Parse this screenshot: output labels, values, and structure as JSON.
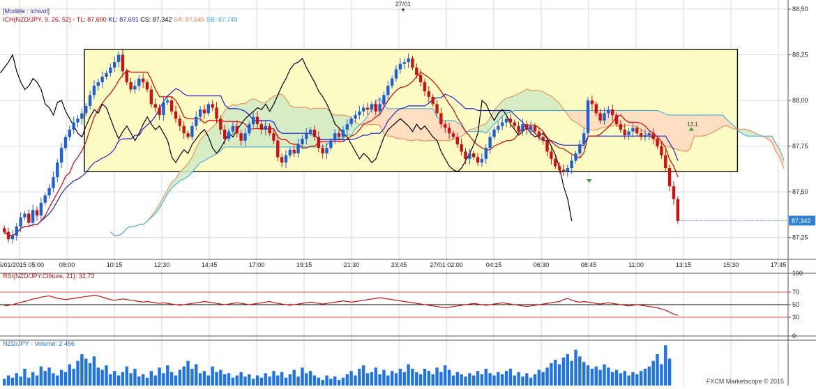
{
  "colors": {
    "background": "#ffffff",
    "grid": "#d9d9d9",
    "bull_candle": "#1f5fd6",
    "bear_candle": "#cc1111",
    "tenkan": "#d40000",
    "kijun": "#2020c8",
    "chikou": "#000000",
    "span_a": "#f0804a",
    "span_b": "#31a8dc",
    "cloud_bull": "#cfe9c4",
    "cloud_bear": "#fbd9c0",
    "cloud_blue": "#cfe6f5",
    "highlight_box": "#fdfbc4",
    "rsi_line": "#cc1111",
    "rsi_levels": "#e85050",
    "volume_bar": "#1f73e6"
  },
  "header": {
    "date_marker": "27/01",
    "model_label": "[Modèle : ichivol]",
    "ichimoku_legend": [
      {
        "text": "ICH(NZD/JPY, 9, 26, 52) -",
        "color": "#d40000"
      },
      {
        "text": "TL: 87,600",
        "color": "#d40000"
      },
      {
        "text": "KL: 87,691",
        "color": "#2020c8"
      },
      {
        "text": "CS: 87,342",
        "color": "#000000"
      },
      {
        "text": "SA: 87,645",
        "color": "#f0804a"
      },
      {
        "text": "SB: 87,749",
        "color": "#31a8dc"
      }
    ]
  },
  "price_axis": {
    "ticks": [
      "88,50",
      "88,25",
      "88,00",
      "87,75",
      "87,50",
      "87,25"
    ],
    "current_price_label": "87,342"
  },
  "time_axis": {
    "labels": [
      "26/01/2015 05:00",
      "08:00",
      "10:15",
      "12:30",
      "14:45",
      "17:00",
      "19:15",
      "21:30",
      "23:45",
      "27/01 02:00",
      "04:15",
      "06:30",
      "08:45",
      "11:00",
      "13:15",
      "15:30",
      "17:45"
    ]
  },
  "annotations": {
    "box_count_label": "13,1"
  },
  "rsi_panel": {
    "label": "RSI(NZD/JPY.Clôture, 21): 32,73",
    "axis_ticks": [
      "100",
      "70",
      "50",
      "30",
      "0"
    ]
  },
  "volume_panel": {
    "label": "NZD/JPY - Volume: 2 456"
  },
  "footer": {
    "credit": "FXCM Marketscope © 2015"
  },
  "chart_data": {
    "type": "candlestick",
    "symbol": "NZD/JPY",
    "title": "ICH(NZD/JPY, 9, 26, 52)",
    "ylim": [
      87.13,
      88.55
    ],
    "price_ticks": [
      88.5,
      88.25,
      88.0,
      87.75,
      87.5,
      87.25
    ],
    "last_price": 87.342,
    "highlight_range": {
      "high": 88.28,
      "low": 87.61,
      "from_bar": 20,
      "to_bar": 180
    },
    "x_labels": [
      "26/01/2015 05:00",
      "08:00",
      "10:15",
      "12:30",
      "14:45",
      "17:00",
      "19:15",
      "21:30",
      "23:45",
      "27/01 02:00",
      "04:15",
      "06:30",
      "08:45",
      "11:00",
      "13:15",
      "15:30",
      "17:45"
    ],
    "closes": [
      87.28,
      87.24,
      87.26,
      87.31,
      87.36,
      87.38,
      87.33,
      87.4,
      87.37,
      87.44,
      87.48,
      87.52,
      87.58,
      87.66,
      87.74,
      87.8,
      87.84,
      87.88,
      87.9,
      87.93,
      87.97,
      88.03,
      88.08,
      88.1,
      88.13,
      88.15,
      88.18,
      88.21,
      88.25,
      88.16,
      88.1,
      88.06,
      88.08,
      88.12,
      88.1,
      88.06,
      87.98,
      87.96,
      87.92,
      87.99,
      88.0,
      87.94,
      87.9,
      87.86,
      87.82,
      87.8,
      87.86,
      87.91,
      87.95,
      87.93,
      87.98,
      87.96,
      87.9,
      87.84,
      87.79,
      87.83,
      87.86,
      87.82,
      87.78,
      87.82,
      87.87,
      87.91,
      87.87,
      87.84,
      87.86,
      87.82,
      87.78,
      87.69,
      87.66,
      87.7,
      87.73,
      87.71,
      87.76,
      87.79,
      87.82,
      87.84,
      87.8,
      87.74,
      87.71,
      87.74,
      87.78,
      87.82,
      87.8,
      87.84,
      87.87,
      87.9,
      87.92,
      87.94,
      87.96,
      87.95,
      87.98,
      87.94,
      87.98,
      88.03,
      88.08,
      88.12,
      88.17,
      88.2,
      88.21,
      88.23,
      88.18,
      88.14,
      88.1,
      88.05,
      88.02,
      87.98,
      87.93,
      87.87,
      87.85,
      87.82,
      87.8,
      87.76,
      87.72,
      87.68,
      87.71,
      87.69,
      87.66,
      87.68,
      87.74,
      87.8,
      87.84,
      87.86,
      87.88,
      87.9,
      87.88,
      87.86,
      87.83,
      87.87,
      87.84,
      87.86,
      87.83,
      87.8,
      87.78,
      87.72,
      87.68,
      87.64,
      87.62,
      87.61,
      87.63,
      87.67,
      87.71,
      87.76,
      87.82,
      88.0,
      87.98,
      87.93,
      87.89,
      87.93,
      87.95,
      87.92,
      87.87,
      87.84,
      87.81,
      87.83,
      87.85,
      87.82,
      87.8,
      87.81,
      87.82,
      87.79,
      87.75,
      87.7,
      87.63,
      87.53,
      87.46,
      87.34
    ],
    "span_a_note": "SA: 87,645",
    "span_b_note": "SB: 87,749",
    "rsi": {
      "period": 21,
      "last": 32.73,
      "levels": [
        70,
        50,
        30
      ],
      "ylim": [
        0,
        100
      ],
      "values": [
        48,
        49,
        50,
        52,
        54,
        55,
        57,
        59,
        60,
        62,
        63,
        64,
        62,
        60,
        59,
        58,
        59,
        60,
        61,
        62,
        63,
        64,
        65,
        64,
        62,
        60,
        58,
        57,
        58,
        59,
        58,
        57,
        56,
        55,
        54,
        55,
        54,
        53,
        52,
        53,
        52,
        51,
        50,
        49,
        50,
        51,
        52,
        53,
        54,
        55,
        54,
        53,
        52,
        51,
        50,
        51,
        52,
        53,
        52,
        51,
        50,
        51,
        52,
        53,
        54,
        55,
        53,
        52,
        51,
        50,
        49,
        50,
        51,
        52,
        53,
        54,
        53,
        52,
        51,
        52,
        53,
        54,
        55,
        56,
        55,
        54,
        55,
        56,
        57,
        58,
        59,
        60,
        61,
        60,
        59,
        58,
        57,
        56,
        55,
        54,
        53,
        52,
        51,
        50,
        49,
        48,
        47,
        46,
        45,
        46,
        47,
        48,
        49,
        50,
        51,
        52,
        51,
        50,
        49,
        50,
        51,
        52,
        53,
        52,
        51,
        50,
        49,
        48,
        47,
        48,
        49,
        50,
        51,
        52,
        53,
        54,
        55,
        58,
        60,
        57,
        55,
        54,
        55,
        54,
        53,
        52,
        51,
        52,
        53,
        52,
        51,
        50,
        49,
        48,
        49,
        50,
        49,
        48,
        47,
        46,
        45,
        43,
        41,
        38,
        35,
        33
      ]
    },
    "volume": {
      "last": 2456,
      "values": [
        600,
        900,
        700,
        1100,
        800,
        1500,
        700,
        1200,
        900,
        1700,
        1300,
        1600,
        1100,
        900,
        1400,
        1200,
        1900,
        1500,
        2200,
        2800,
        2400,
        2000,
        2600,
        1600,
        1400,
        1800,
        1000,
        1300,
        900,
        1200,
        1700,
        1100,
        1500,
        800,
        1000,
        700,
        1300,
        900,
        1600,
        1100,
        1800,
        1200,
        900,
        1400,
        1700,
        2200,
        1500,
        1900,
        1100,
        1300,
        900,
        1700,
        1200,
        1400,
        1000,
        1100,
        700,
        900,
        1200,
        800,
        1000,
        600,
        900,
        700,
        1100,
        800,
        1300,
        900,
        1200,
        700,
        1000,
        1400,
        800,
        1600,
        1100,
        1300,
        900,
        700,
        500,
        900,
        600,
        800,
        500,
        700,
        1000,
        1300,
        900,
        1500,
        1800,
        1100,
        1200,
        1600,
        1000,
        1400,
        900,
        1300,
        1100,
        1500,
        1200,
        1900,
        1500,
        1200,
        1000,
        1500,
        1300,
        1000,
        1600,
        1200,
        1800,
        1400,
        900,
        1200,
        1000,
        800,
        1100,
        900,
        1300,
        1000,
        1500,
        1100,
        900,
        1200,
        1000,
        1300,
        1500,
        900,
        1200,
        800,
        1100,
        700,
        1000,
        1400,
        1200,
        1600,
        2000,
        2300,
        1900,
        2500,
        2800,
        2200,
        3200,
        2600,
        2100,
        1800,
        1500,
        1700,
        1400,
        1900,
        1600,
        1200,
        1400,
        1100,
        1300,
        900,
        1200,
        1000,
        1300,
        1500,
        1700,
        2200,
        2800,
        1900,
        3600,
        2400
      ]
    }
  }
}
